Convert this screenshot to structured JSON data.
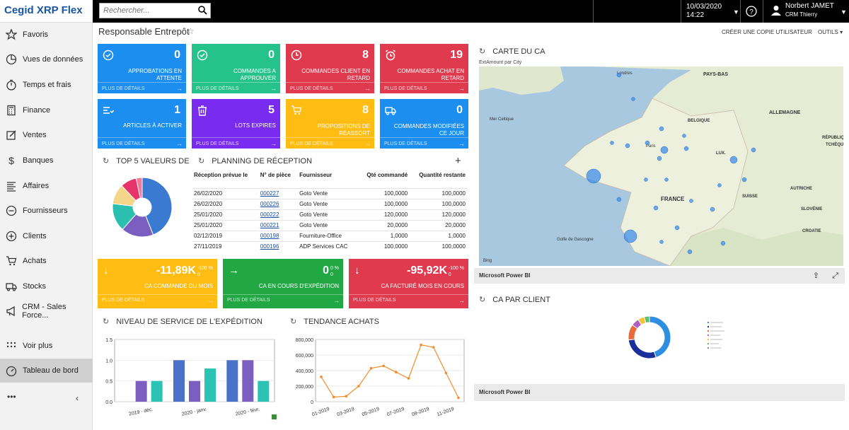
{
  "app": {
    "brand": "Cegid XRP Flex"
  },
  "search": {
    "placeholder": "Rechercher..."
  },
  "topbar": {
    "date": "10/03/2020",
    "time": "14:22",
    "user_name": "Norbert JAMET",
    "user_company": "CRM Thierry"
  },
  "sidebar": {
    "items": [
      {
        "label": "Favoris",
        "icon": "star-icon"
      },
      {
        "label": "Vues de données",
        "icon": "pie-icon"
      },
      {
        "label": "Temps et frais",
        "icon": "timer-icon"
      },
      {
        "label": "Finance",
        "icon": "calculator-icon"
      },
      {
        "label": "Ventes",
        "icon": "edit-icon"
      },
      {
        "label": "Banques",
        "icon": "dollar-icon"
      },
      {
        "label": "Affaires",
        "icon": "tasks-icon"
      },
      {
        "label": "Fournisseurs",
        "icon": "minus-circle-icon"
      },
      {
        "label": "Clients",
        "icon": "plus-circle-icon"
      },
      {
        "label": "Achats",
        "icon": "cart-icon"
      },
      {
        "label": "Stocks",
        "icon": "truck-icon"
      },
      {
        "label": "CRM - Sales Force...",
        "icon": "megaphone-icon"
      },
      {
        "label": "Voir plus",
        "icon": "grid-icon"
      },
      {
        "label": "Tableau de bord",
        "icon": "dashboard-icon"
      }
    ],
    "footer_dots": "•••",
    "collapse": "‹"
  },
  "page": {
    "title": "Responsable Entrepôt",
    "copy_action": "CRÉER UNE COPIE UTILISATEUR",
    "tools": "OUTILS"
  },
  "tiles": [
    {
      "value": "0",
      "label1": "APPROBATIONS EN",
      "label2": "ATTENTE",
      "more": "PLUS DE DÉTAILS",
      "color": "#1c8ef0",
      "icon": "check-badge-icon"
    },
    {
      "value": "0",
      "label1": "COMMANDES A",
      "label2": "APPROUVER",
      "more": "PLUS DE DÉTAILS",
      "color": "#26c28c",
      "icon": "check-badge-icon"
    },
    {
      "value": "8",
      "label1": "COMMANDES CLIENT EN",
      "label2": "RETARD",
      "more": "PLUS DE DÉTAILS",
      "color": "#e03a4e",
      "icon": "clock-icon"
    },
    {
      "value": "19",
      "label1": "COMMANDES ACHAT EN",
      "label2": "RETARD",
      "more": "PLUS DE DÉTAILS",
      "color": "#e03a4e",
      "icon": "alarm-icon"
    },
    {
      "value": "1",
      "label1": "ARTICLES À ACTIVER",
      "label2": "",
      "more": "PLUS DE DÉTAILS",
      "color": "#1c8ef0",
      "icon": "list-icon"
    },
    {
      "value": "5",
      "label1": "LOTS EXPIRES",
      "label2": "",
      "more": "PLUS DE DÉTAILS",
      "color": "#7a2bf0",
      "icon": "trash-icon"
    },
    {
      "value": "8",
      "label1": "PROPOSITIONS DE",
      "label2": "RÉASSORT",
      "more": "PLUS DE DÉTAILS",
      "color": "#ffbc12",
      "icon": "cart-icon"
    },
    {
      "value": "0",
      "label1": "COMMANDES MODIFIÉES",
      "label2": "CE JOUR",
      "more": "PLUS DE DÉTAILS",
      "color": "#1c8ef0",
      "icon": "truck-icon"
    }
  ],
  "sections": {
    "top5": "TOP 5 VALEURS DE",
    "planning": "PLANNING DE RÉCEPTION",
    "service": "NIVEAU DE SERVICE DE L'EXPÉDITION",
    "tendance": "TENDANCE ACHATS",
    "carte": "CARTE DU CA",
    "caclient": "CA PAR CLIENT"
  },
  "planning_table": {
    "headers": [
      "Réception prévue le",
      "N° de pièce",
      "Fournisseur",
      "Qté commandé",
      "Quantité restante"
    ],
    "rows": [
      [
        "26/02/2020",
        "000227",
        "Goto Vente",
        "100,0000",
        "100,0000"
      ],
      [
        "26/02/2020",
        "000226",
        "Goto Vente",
        "100,0000",
        "100,0000"
      ],
      [
        "25/01/2020",
        "000222",
        "Goto Vente",
        "120,0000",
        "120,0000"
      ],
      [
        "25/01/2020",
        "000221",
        "Goto Vente",
        "20,0000",
        "20,0000"
      ],
      [
        "02/12/2019",
        "000198",
        "Fourniture-Office",
        "1,0000",
        "1,0000"
      ],
      [
        "27/11/2019",
        "000196",
        "ADP Services CAC",
        "100,0000",
        "100,0000"
      ]
    ]
  },
  "kpis": [
    {
      "value": "-11,89K",
      "pct1": "-100 %",
      "pct2": "0",
      "label": "CA COMMANDE DU MOIS",
      "more": "PLUS DE DÉTAILS",
      "color": "#ffbc12",
      "arrow": "↓"
    },
    {
      "value": "0",
      "pct1": "0 %",
      "pct2": "0",
      "label": "CA EN COURS D'EXPÉDITION",
      "more": "PLUS DE DÉTAILS",
      "color": "#21a845",
      "arrow": "→"
    },
    {
      "value": "-95,92K",
      "pct1": "-100 %",
      "pct2": "0",
      "label": "CA FACTURÉ MOIS EN COURS",
      "more": "PLUS DE DÉTAILS",
      "color": "#e03a4e",
      "arrow": "↓"
    }
  ],
  "map": {
    "subtitle": "ExtAmount par City",
    "labels": [
      "PAYS-BAS",
      "ALLEMAGNE",
      "BELGIQUE",
      "LUX.",
      "FRANCE",
      "SUISSE",
      "AUTRICHE",
      "SLOVÉNIE",
      "CROATIE",
      "RÉPUBLIQUE",
      "TCHÈQUE",
      "Mer Celtique",
      "Golfe de Gascogne",
      "Londres",
      "Paris"
    ],
    "bing": "Bing",
    "footer": "Microsoft Power BI"
  },
  "caclient": {
    "footer": "Microsoft Power BI"
  },
  "chart_data": [
    {
      "type": "pie",
      "title": "TOP 5 VALEURS DE",
      "slices": [
        {
          "value": 40,
          "color": "#3a7ad1"
        },
        {
          "value": 16,
          "color": "#7b5fc0"
        },
        {
          "value": 14,
          "color": "#2bbfb0"
        },
        {
          "value": 10,
          "color": "#f5d58a"
        },
        {
          "value": 8,
          "color": "#e8336a"
        },
        {
          "value": 3,
          "color": "#f07a9a"
        }
      ]
    },
    {
      "type": "bar",
      "title": "NIVEAU DE SERVICE DE L'EXPÉDITION",
      "categories": [
        "2019 - déc.",
        "2020 - janv.",
        "2020 - févr."
      ],
      "series": [
        {
          "values": [
            0,
            1.0,
            1.0
          ],
          "color": "#4a72c8"
        },
        {
          "values": [
            0.5,
            0.5,
            1.0
          ],
          "color": "#7a5fc0"
        },
        {
          "values": [
            0.5,
            0.8,
            0.5
          ],
          "color": "#2bc3b3"
        }
      ],
      "ylim": [
        0,
        1.5
      ],
      "yticks": [
        "0.0",
        "0.5",
        "1.0",
        "1.5"
      ],
      "grid": true
    },
    {
      "type": "line",
      "title": "TENDANCE ACHATS",
      "x": [
        "01-2019",
        "02-2019",
        "03-2019",
        "04-2019",
        "05-2019",
        "06-2019",
        "07-2019",
        "08-2019",
        "09-2019",
        "10-2019",
        "11-2019",
        "12-2019"
      ],
      "xticks": [
        "01-2019",
        "03-2019",
        "05-2019",
        "07-2019",
        "09-2019",
        "11-2019"
      ],
      "values": [
        320000,
        60000,
        70000,
        200000,
        430000,
        460000,
        380000,
        300000,
        730000,
        700000,
        370000,
        50000
      ],
      "ylim": [
        0,
        800000
      ],
      "yticks": [
        "0",
        "200,000",
        "400,000",
        "600,000",
        "800,000"
      ],
      "color": "#f28c28",
      "grid": true
    },
    {
      "type": "pie",
      "title": "CA PAR CLIENT",
      "slices": [
        {
          "value": 45,
          "color": "#2e8fe0"
        },
        {
          "value": 28,
          "color": "#1b2f9c"
        },
        {
          "value": 12,
          "color": "#e86a3a"
        },
        {
          "value": 6,
          "color": "#b15fc0"
        },
        {
          "value": 5,
          "color": "#f5c23a"
        },
        {
          "value": 4,
          "color": "#5ac06a"
        }
      ]
    }
  ]
}
